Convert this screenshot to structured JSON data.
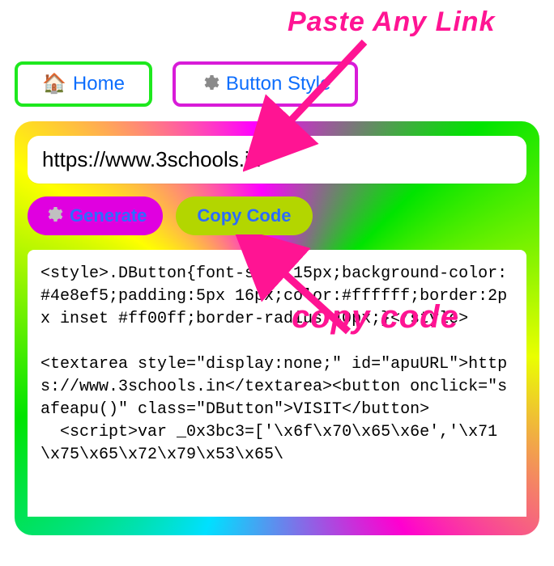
{
  "nav": {
    "home_label": "Home",
    "style_label": "Button Style"
  },
  "panel": {
    "url_value": "https://www.3schools.in",
    "generate_label": "Generate",
    "copy_label": "Copy Code",
    "code_output": "<style>.DButton{font-size:15px;background-color:#4e8ef5;padding:5px 16px;color:#ffffff;border:2px inset #ff00ff;border-radius:40px;}</style>\n\n<textarea style=\"display:none;\" id=\"apuURL\">https://www.3schools.in</textarea><button onclick=\"safeapu()\" class=\"DButton\">VISIT</button>\n  <script>var _0x3bc3=['\\x6f\\x70\\x65\\x6e','\\x71\\x75\\x65\\x72\\x79\\x53\\x65\\"
  },
  "callouts": {
    "paste": "Paste Any Link",
    "copy": "copy code"
  },
  "icons": {
    "home": "🏠",
    "gear": "⚙️"
  }
}
